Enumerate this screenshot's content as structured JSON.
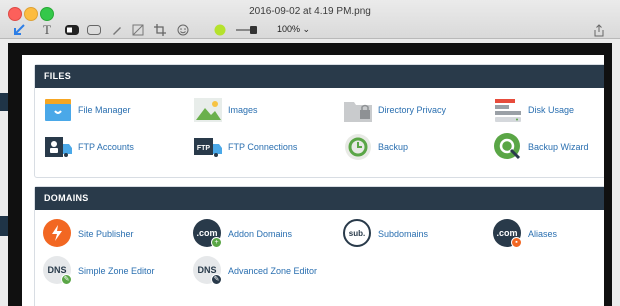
{
  "window": {
    "title": "2016-09-02 at 4.19 PM.png"
  },
  "toolbar": {
    "zoom": "100%"
  },
  "files": {
    "heading": "FILES",
    "items": [
      {
        "label": "File Manager",
        "icon": "file-manager-icon"
      },
      {
        "label": "Images",
        "icon": "images-icon"
      },
      {
        "label": "Directory Privacy",
        "icon": "directory-privacy-icon"
      },
      {
        "label": "Disk Usage",
        "icon": "disk-usage-icon"
      },
      {
        "label": "FTP Accounts",
        "icon": "ftp-accounts-icon"
      },
      {
        "label": "FTP Connections",
        "icon": "ftp-connections-icon"
      },
      {
        "label": "Backup",
        "icon": "backup-icon"
      },
      {
        "label": "Backup Wizard",
        "icon": "backup-wizard-icon"
      }
    ]
  },
  "domains": {
    "heading": "DOMAINS",
    "items": [
      {
        "label": "Site Publisher",
        "icon": "site-publisher-icon"
      },
      {
        "label": "Addon Domains",
        "icon": "addon-domains-icon",
        "badge": ".com"
      },
      {
        "label": "Subdomains",
        "icon": "subdomains-icon",
        "badge": "sub."
      },
      {
        "label": "Aliases",
        "icon": "aliases-icon",
        "badge": ".com"
      },
      {
        "label": "Simple Zone Editor",
        "icon": "simple-zone-editor-icon",
        "badge": "DNS"
      },
      {
        "label": "Advanced Zone Editor",
        "icon": "advanced-zone-editor-icon",
        "badge": "DNS"
      }
    ]
  },
  "colors": {
    "header": "#293a4a",
    "link": "#2a6fb0",
    "orange": "#f26722",
    "dark": "#293a4a",
    "green": "#5aa646"
  }
}
